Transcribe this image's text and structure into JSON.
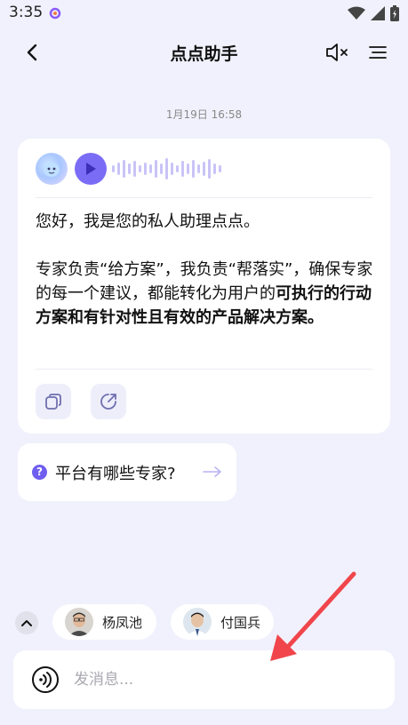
{
  "status_bar": {
    "time": "3:35"
  },
  "header": {
    "title": "点点助手"
  },
  "timestamp": "1月19日 16:58",
  "message": {
    "greeting": "您好，我是您的私人助理点点。",
    "body_plain": "专家负责“给方案”，我负责“帮落实”，确保专家的每一个建议，都能转化为用户的",
    "body_bold": "可执行的行动方案和有针对性且有效的产品解决方案。"
  },
  "suggestion": {
    "badge": "?",
    "text": "平台有哪些专家?"
  },
  "experts": [
    {
      "name": "杨凤池"
    },
    {
      "name": "付国兵"
    }
  ],
  "input": {
    "placeholder": "发消息..."
  },
  "colors": {
    "accent": "#7B6CF6",
    "background": "#F1F1FD",
    "annotation_arrow": "#F0464B"
  }
}
